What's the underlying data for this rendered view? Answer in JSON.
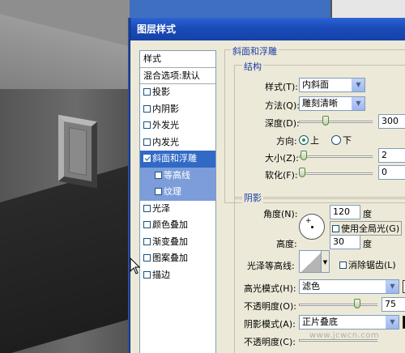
{
  "dialog": {
    "title": "图层样式"
  },
  "style_list": {
    "header": "样式",
    "blend": "混合选项:默认",
    "items": [
      {
        "label": "投影",
        "checked": false
      },
      {
        "label": "内阴影",
        "checked": false
      },
      {
        "label": "外发光",
        "checked": false
      },
      {
        "label": "内发光",
        "checked": false
      },
      {
        "label": "斜面和浮雕",
        "checked": true,
        "selected": true
      },
      {
        "label": "等高线",
        "checked": false,
        "sub": true
      },
      {
        "label": "纹理",
        "checked": false,
        "sub": true
      },
      {
        "label": "光泽",
        "checked": false
      },
      {
        "label": "颜色叠加",
        "checked": false
      },
      {
        "label": "渐变叠加",
        "checked": false
      },
      {
        "label": "图案叠加",
        "checked": false
      },
      {
        "label": "描边",
        "checked": false
      }
    ]
  },
  "bevel": {
    "section_title": "斜面和浮雕",
    "structure_title": "结构",
    "style_label": "样式(T):",
    "style_value": "内斜面",
    "technique_label": "方法(Q):",
    "technique_value": "雕刻清晰",
    "depth_label": "深度(D):",
    "depth_value": "300",
    "direction_label": "方向:",
    "direction_up": "上",
    "direction_down": "下",
    "size_label": "大小(Z):",
    "size_value": "2",
    "soften_label": "软化(F):",
    "soften_value": "0"
  },
  "shading": {
    "title": "阴影",
    "angle_label": "角度(N):",
    "angle_value": "120",
    "angle_unit": "度",
    "global_light_label": "使用全局光(G)",
    "altitude_label": "高度:",
    "altitude_value": "30",
    "altitude_unit": "度",
    "gloss_label": "光泽等高线:",
    "antialias_label": "消除锯齿(L)",
    "highlight_mode_label": "高光模式(H):",
    "highlight_mode_value": "滤色",
    "highlight_opacity_label": "不透明度(O):",
    "highlight_opacity_value": "75",
    "shadow_mode_label": "阴影模式(A):",
    "shadow_mode_value": "正片叠底",
    "shadow_opacity_label": "不透明度(C):"
  },
  "colors": {
    "titlebar": "#1a4bb8",
    "selected": "#316ac5",
    "group_title": "#1a3fa6",
    "highlight_swatch": "#ffffff",
    "shadow_swatch": "#000000"
  },
  "watermark": "www.jcwcn.com"
}
